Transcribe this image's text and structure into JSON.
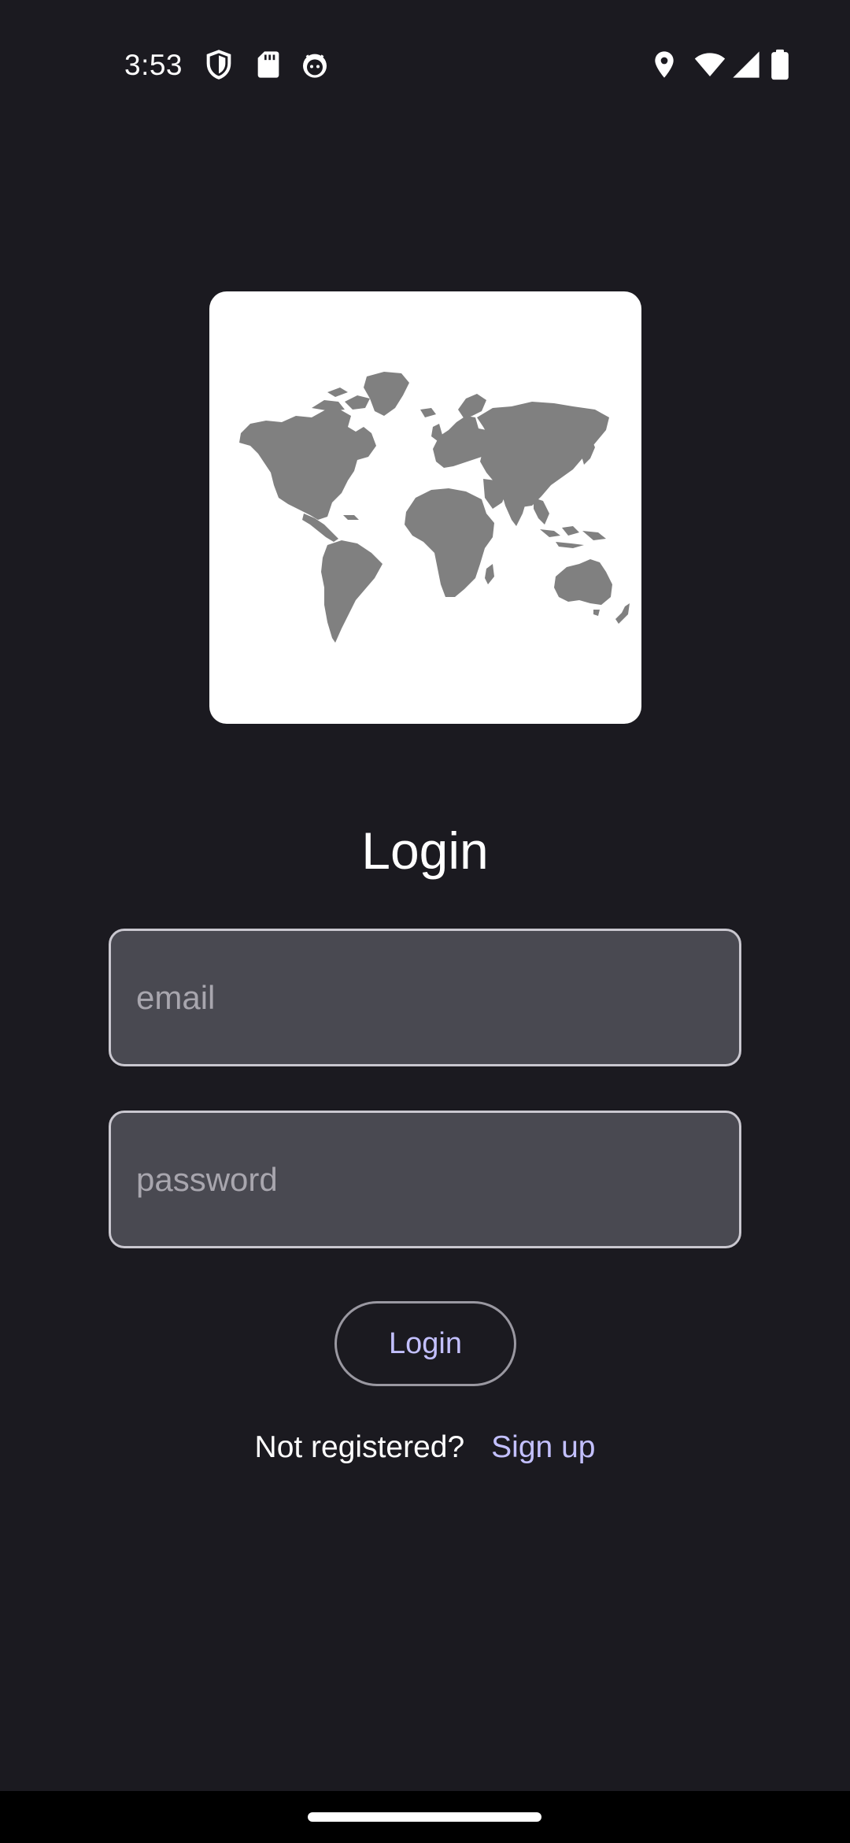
{
  "status_bar": {
    "time": "3:53",
    "left_icons": [
      "shield-icon",
      "sd-card-icon",
      "robot-face-icon"
    ],
    "right_icons": [
      "location-icon",
      "wifi-icon",
      "cell-signal-icon",
      "battery-icon"
    ]
  },
  "hero": {
    "icon": "world-map-icon"
  },
  "form": {
    "title": "Login",
    "email_placeholder": "email",
    "email_value": "",
    "password_placeholder": "password",
    "password_value": "",
    "login_button_label": "Login"
  },
  "footer": {
    "prompt": "Not registered?",
    "signup_link": "Sign up"
  },
  "colors": {
    "background": "#1b1a20",
    "input_fill": "#494951",
    "accent": "#c3c0ff",
    "map_land": "#808080"
  }
}
